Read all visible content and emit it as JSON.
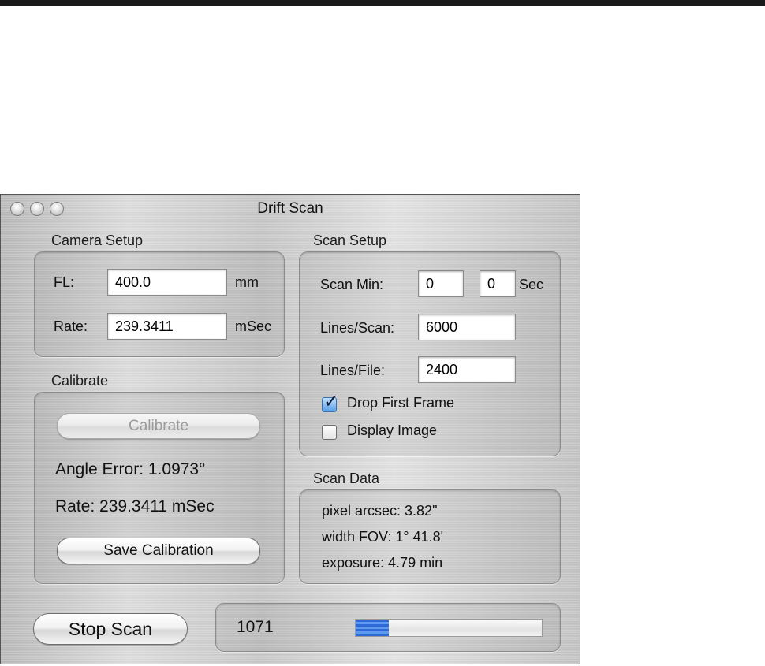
{
  "window": {
    "title": "Drift Scan"
  },
  "camera_setup": {
    "title": "Camera Setup",
    "fl_label": "FL:",
    "fl_value": "400.0",
    "fl_unit": "mm",
    "rate_label": "Rate:",
    "rate_value": "239.3411",
    "rate_unit": "mSec"
  },
  "calibrate": {
    "title": "Calibrate",
    "calibrate_button": "Calibrate",
    "angle_error": "Angle Error: 1.0973°",
    "rate": "Rate: 239.3411 mSec",
    "save_button": "Save Calibration"
  },
  "scan_setup": {
    "title": "Scan Setup",
    "scan_min_label": "Scan Min:",
    "scan_min_value": "0",
    "scan_sec_value": "0",
    "sec_unit": "Sec",
    "lines_scan_label": "Lines/Scan:",
    "lines_scan_value": "6000",
    "lines_file_label": "Lines/File:",
    "lines_file_value": "2400",
    "drop_first_frame_label": "Drop First Frame",
    "drop_first_frame_checked": true,
    "display_image_label": "Display Image",
    "display_image_checked": false
  },
  "scan_data": {
    "title": "Scan Data",
    "pixel_arcsec": "pixel arcsec: 3.82\"",
    "width_fov": "width FOV: 1° 41.8'",
    "exposure": "exposure: 4.79 min"
  },
  "status": {
    "stop_button": "Stop Scan",
    "count": "1071",
    "progress_fraction": 0.18
  },
  "colors": {
    "progress": "#2f69d8",
    "check_on": "#5a9fe8"
  }
}
